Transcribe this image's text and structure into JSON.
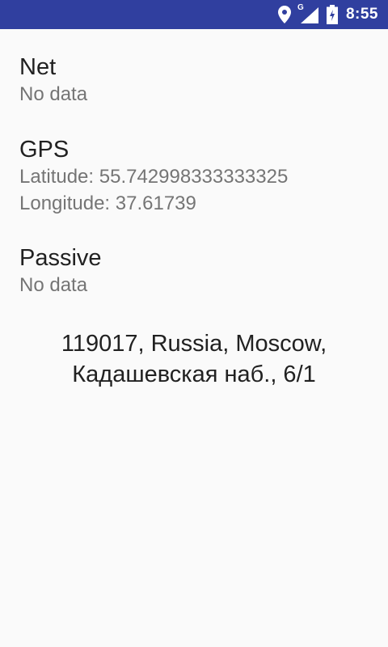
{
  "status_bar": {
    "time": "8:55",
    "network_type": "G",
    "icons": [
      "location-pin-icon",
      "signal-icon",
      "battery-icon"
    ],
    "background_color": "#303f9f"
  },
  "sections": {
    "net": {
      "title": "Net",
      "body": "No data"
    },
    "gps": {
      "title": "GPS",
      "latitude": "Latitude: 55.742998333333325",
      "longitude": "Longitude: 37.61739"
    },
    "passive": {
      "title": "Passive",
      "body": "No data"
    }
  },
  "address": {
    "line1": "119017, Russia, Moscow,",
    "line2": "Кадашевская наб., 6/1"
  }
}
